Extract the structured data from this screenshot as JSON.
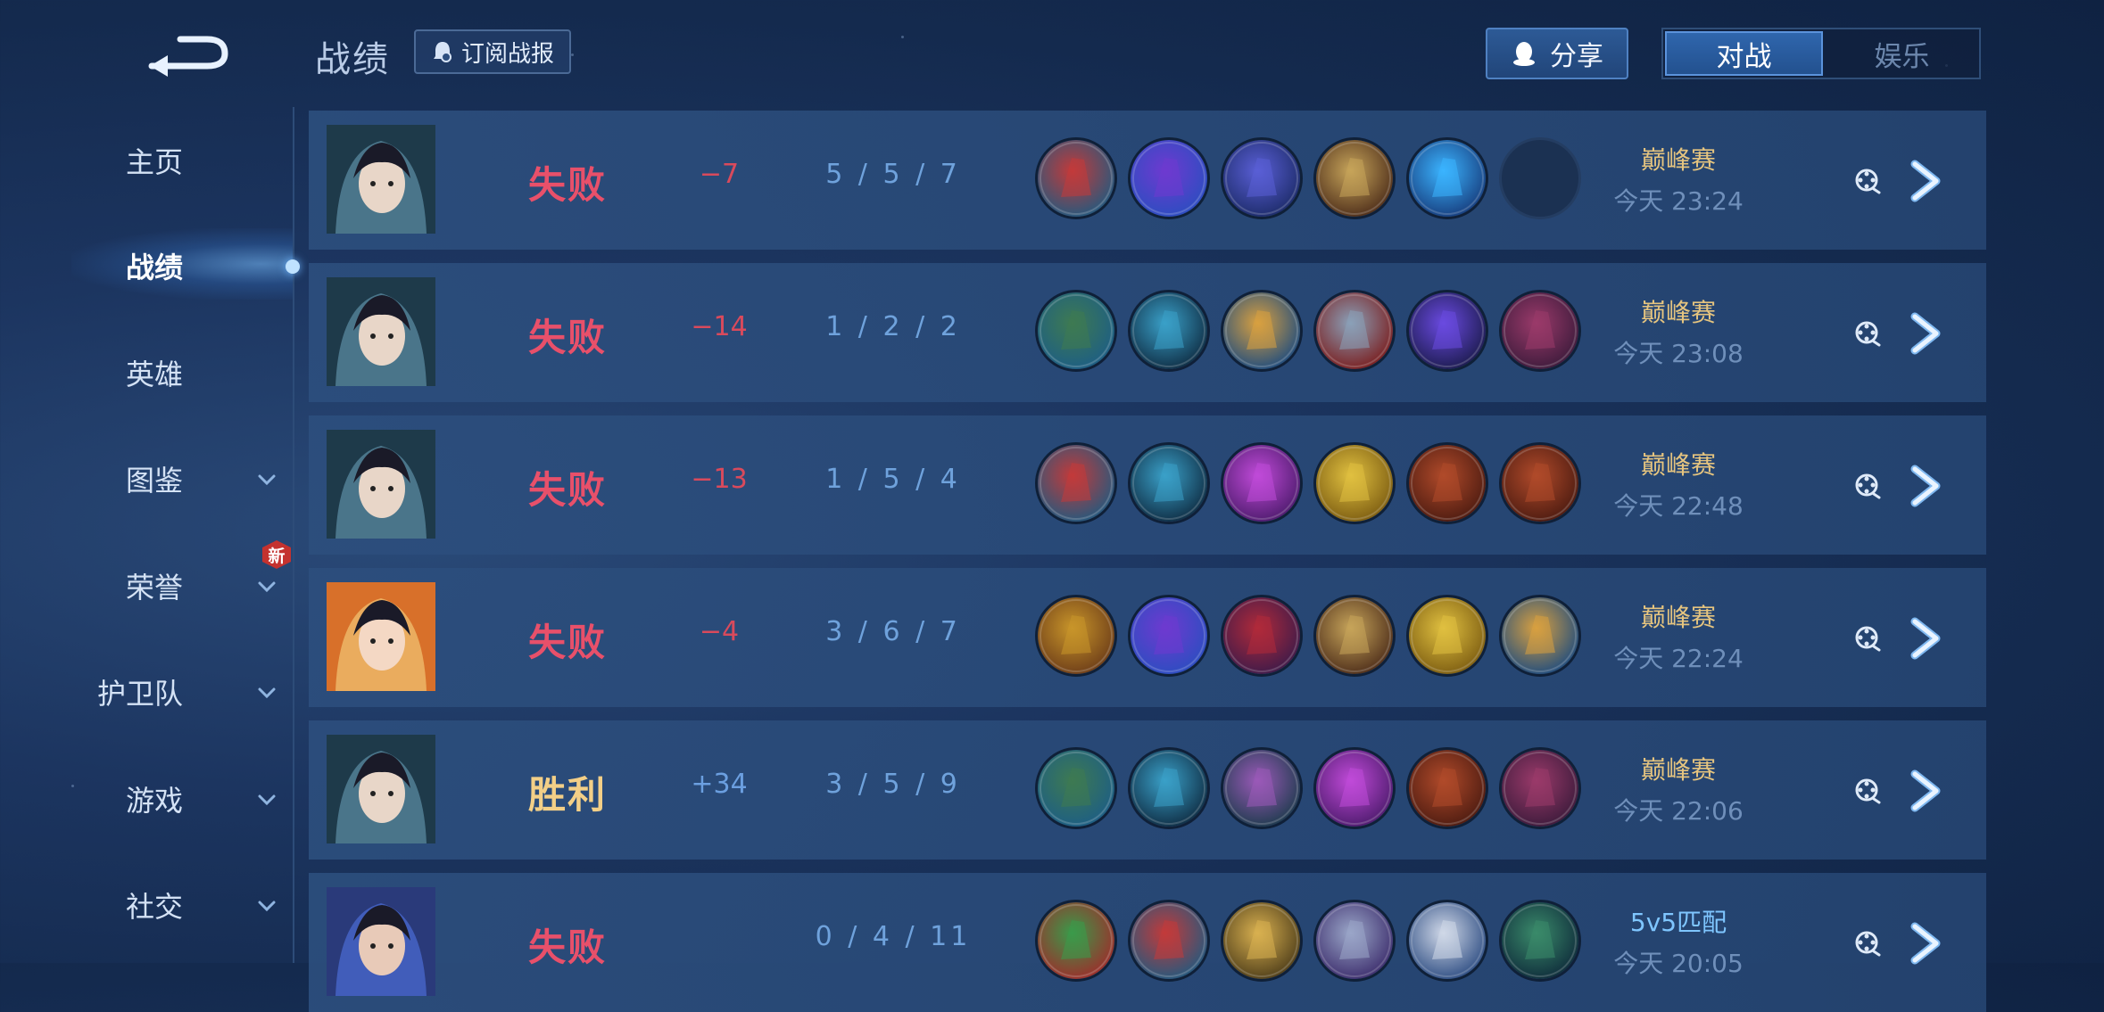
{
  "header": {
    "title": "战绩",
    "subscribe_label": "订阅战报",
    "share_label": "分享",
    "tabs": [
      {
        "label": "对战",
        "active": true
      },
      {
        "label": "娱乐",
        "active": false
      }
    ]
  },
  "sidebar": {
    "items": [
      {
        "label": "主页",
        "has_dropdown": false
      },
      {
        "label": "战绩",
        "has_dropdown": false,
        "active": true
      },
      {
        "label": "英雄",
        "has_dropdown": false
      },
      {
        "label": "图鉴",
        "has_dropdown": true
      },
      {
        "label": "荣誉",
        "has_dropdown": true,
        "badge": "新"
      },
      {
        "label": "护卫队",
        "has_dropdown": true
      },
      {
        "label": "游戏",
        "has_dropdown": true
      },
      {
        "label": "社交",
        "has_dropdown": true
      }
    ]
  },
  "colors": {
    "lose": "#e8506a",
    "win": "#f3cf87",
    "accent": "#2f66ad",
    "mode_peak": "#e5c47f",
    "mode_match": "#7fc6ff"
  },
  "matches": [
    {
      "hero": "dark-haired-heroine-portrait",
      "result": "失败",
      "outcome": "lose",
      "score_change": "−7",
      "kda": "5 / 5 / 7",
      "mode": "巅峰赛",
      "time": "今天 23:24",
      "items": [
        "red-boots-icon",
        "purple-dragon-icon",
        "ice-staff-icon",
        "spellbook-icon",
        "blue-crystal-icon",
        "empty-slot"
      ]
    },
    {
      "hero": "dark-haired-heroine-portrait",
      "result": "失败",
      "outcome": "lose",
      "score_change": "−14",
      "kda": "1 / 2 / 2",
      "mode": "巅峰赛",
      "time": "今天 23:08",
      "items": [
        "green-boots-icon",
        "scythe-icon",
        "golden-staff-icon",
        "armor-icon",
        "void-orb-icon",
        "purple-tome-icon"
      ]
    },
    {
      "hero": "dark-haired-heroine-portrait",
      "result": "失败",
      "outcome": "lose",
      "score_change": "−13",
      "kda": "1 / 5 / 4",
      "mode": "巅峰赛",
      "time": "今天 22:48",
      "items": [
        "red-boots-icon",
        "scythe-icon",
        "purple-cloak-icon",
        "gold-scepter-icon",
        "red-tome-icon",
        "red-tome-icon"
      ]
    },
    {
      "hero": "golden-haired-heroine-portrait",
      "result": "失败",
      "outcome": "lose",
      "score_change": "−4",
      "kda": "3 / 6 / 7",
      "mode": "巅峰赛",
      "time": "今天 22:24",
      "items": [
        "gold-boots-icon",
        "purple-dragon-icon",
        "crimson-hood-icon",
        "spellbook-icon",
        "gold-scepter-icon",
        "golden-staff-icon"
      ]
    },
    {
      "hero": "dark-haired-heroine-portrait",
      "result": "胜利",
      "outcome": "win",
      "score_change": "+34",
      "kda": "3 / 5 / 9",
      "mode": "巅峰赛",
      "time": "今天 22:06",
      "items": [
        "green-boots-icon",
        "scythe-icon",
        "skull-mask-icon",
        "purple-cloak-icon",
        "red-tome-icon",
        "purple-tome-icon"
      ]
    },
    {
      "hero": "dark-haired-warrior-portrait",
      "result": "失败",
      "outcome": "lose",
      "score_change": "",
      "kda": "0 / 4 / 11",
      "mode": "5v5匹配",
      "time": "今天 20:05",
      "items": [
        "jade-dragon-icon",
        "red-boots-icon",
        "golden-knight-icon",
        "silver-armor-icon",
        "white-mask-icon",
        "green-hood-icon"
      ]
    }
  ]
}
